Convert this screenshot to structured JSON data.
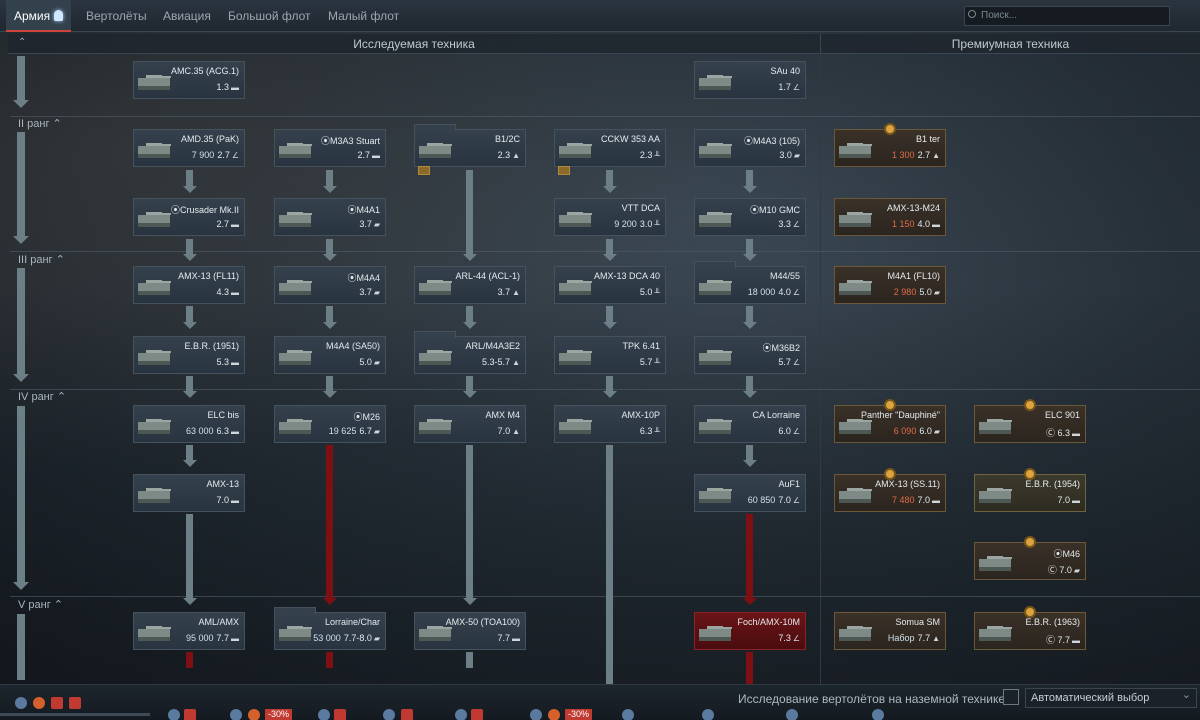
{
  "tabs": [
    {
      "label": "Армия",
      "active": true
    },
    {
      "label": "Вертолёты"
    },
    {
      "label": "Авиация"
    },
    {
      "label": "Большой флот"
    },
    {
      "label": "Малый флот"
    }
  ],
  "search": {
    "placeholder": "Поиск..."
  },
  "header": {
    "researchable": "Исследуемая техника",
    "premium": "Премиумная техника"
  },
  "ranks": {
    "r2": "II ранг",
    "r3": "III ранг",
    "r4": "IV ранг",
    "r5": "V ранг"
  },
  "vehicles": {
    "amc35": {
      "name": "AMC.35 (ACG.1)",
      "br": "1.3"
    },
    "sau40": {
      "name": "SAu 40",
      "br": "1.7"
    },
    "amd35": {
      "name": "AMD.35 (PaK)",
      "cost": "7 900",
      "br": "2.7"
    },
    "m3a3": {
      "name": "M3A3 Stuart",
      "br": "2.7"
    },
    "b1_2c": {
      "name": "B1/2C",
      "br": "2.3"
    },
    "cckw": {
      "name": "CCKW 353 AA",
      "br": "2.3"
    },
    "m4a3_105": {
      "name": "M4A3 (105)",
      "br": "3.0"
    },
    "b1ter": {
      "name": "B1 ter",
      "cost": "1 300",
      "br": "2.7"
    },
    "crusader": {
      "name": "Crusader Mk.II",
      "br": "2.7"
    },
    "m4a1": {
      "name": "M4A1",
      "br": "3.7"
    },
    "vtt_dca": {
      "name": "VTT DCA",
      "cost": "9 200",
      "br": "3.0"
    },
    "m10gmc": {
      "name": "M10 GMC",
      "br": "3.3"
    },
    "amx13m24": {
      "name": "AMX-13-M24",
      "cost": "1 150",
      "br": "4.0"
    },
    "amx13fl11": {
      "name": "AMX-13 (FL11)",
      "br": "4.3"
    },
    "m4a4": {
      "name": "M4A4",
      "br": "3.7"
    },
    "arl44acl1": {
      "name": "ARL-44 (ACL-1)",
      "br": "3.7"
    },
    "amx13dca40": {
      "name": "AMX-13 DCA 40",
      "br": "5.0"
    },
    "m44_55": {
      "name": "M44/55",
      "cost": "18 000",
      "br": "4.0"
    },
    "m4a1fl10": {
      "name": "M4A1 (FL10)",
      "cost": "2 980",
      "br": "5.0"
    },
    "ebr1951": {
      "name": "E.B.R. (1951)",
      "br": "5.3"
    },
    "m4a4sa50": {
      "name": "M4A4 (SA50)",
      "br": "5.0"
    },
    "arl_m4a3e2": {
      "name": "ARL/M4A3E2",
      "br": "5.3-5.7"
    },
    "tpk641": {
      "name": "TPK 6.41",
      "br": "5.7"
    },
    "m36b2": {
      "name": "M36B2",
      "br": "5.7"
    },
    "elcbis": {
      "name": "ELC bis",
      "cost": "63 000",
      "br": "6.3"
    },
    "m26": {
      "name": "M26",
      "cost": "19 625",
      "br": "6.7"
    },
    "amxm4": {
      "name": "AMX M4",
      "br": "7.0"
    },
    "amx10p": {
      "name": "AMX-10P",
      "br": "6.3"
    },
    "calorraine": {
      "name": "CA Lorraine",
      "br": "6.0"
    },
    "panther": {
      "name": "Panther \"Dauphiné\"",
      "cost": "6 090",
      "br": "6.0"
    },
    "elc901": {
      "name": "ELC 901",
      "br": "6.3"
    },
    "amx13": {
      "name": "AMX-13",
      "br": "7.0"
    },
    "auf1": {
      "name": "AuF1",
      "cost": "60 850",
      "br": "7.0"
    },
    "amx13ss11": {
      "name": "AMX-13 (SS.11)",
      "cost": "7 480",
      "br": "7.0"
    },
    "ebr1954": {
      "name": "E.B.R. (1954)",
      "br": "7.0"
    },
    "m46": {
      "name": "M46",
      "br": "7.0"
    },
    "aml_amx": {
      "name": "AML/AMX",
      "cost": "95 000",
      "br": "7.7"
    },
    "lorraine_char": {
      "name": "Lorraine/Char",
      "cost": "53 000",
      "br": "7.7-8.0"
    },
    "amx50": {
      "name": "AMX-50 (TOA100)",
      "br": "7.7"
    },
    "foch": {
      "name": "Foch/AMX-10M",
      "br": "7.3"
    },
    "somua": {
      "name": "Somua SM",
      "pack": "Набор",
      "br": "7.7"
    },
    "ebr1963": {
      "name": "E.B.R. (1963)",
      "br": "7.7"
    }
  },
  "bottom": {
    "heli_research": "Исследование вертолётов на наземной технике",
    "auto_select": "Автоматический выбор",
    "discounts": [
      "-30%",
      "-30%"
    ]
  },
  "colors": {
    "accent_red": "#d0433a",
    "premium_border": "#6b5838",
    "locked_red": "#7e0f12"
  }
}
